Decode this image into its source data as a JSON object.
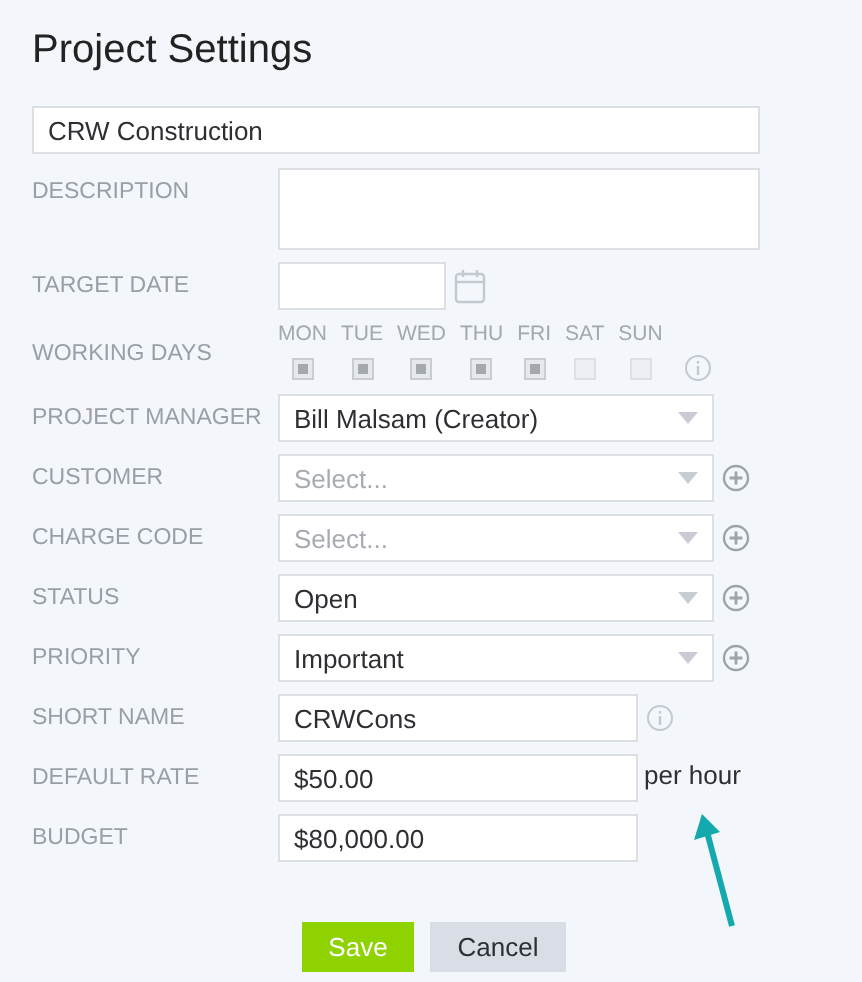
{
  "title": "Project Settings",
  "fields": [
    {
      "kind": "text",
      "value": "CRW Construction"
    },
    {
      "kind": "textarea",
      "label": "DESCRIPTION"
    },
    {
      "kind": "date",
      "label": "TARGET DATE"
    },
    {
      "kind": "days",
      "label": "WORKING DAYS",
      "info": true,
      "days": [
        {
          "label": "MON",
          "checked": true
        },
        {
          "label": "TUE",
          "checked": true
        },
        {
          "label": "WED",
          "checked": true
        },
        {
          "label": "THU",
          "checked": true
        },
        {
          "label": "FRI",
          "checked": true
        },
        {
          "label": "SAT",
          "checked": false
        },
        {
          "label": "SUN",
          "checked": false
        }
      ]
    },
    {
      "kind": "select",
      "label": "PROJECT MANAGER",
      "value": "Bill Malsam (Creator)",
      "addable": false
    },
    {
      "kind": "select",
      "label": "CUSTOMER",
      "placeholder": "Select...",
      "addable": true
    },
    {
      "kind": "select",
      "label": "CHARGE CODE",
      "placeholder": "Select...",
      "addable": true
    },
    {
      "kind": "select",
      "label": "STATUS",
      "value": "Open",
      "addable": true
    },
    {
      "kind": "select",
      "label": "PRIORITY",
      "value": "Important",
      "addable": true
    },
    {
      "kind": "short",
      "label": "SHORT NAME",
      "value": "CRWCons",
      "info": true
    },
    {
      "kind": "short",
      "label": "DEFAULT RATE",
      "value": "$50.00",
      "info": false,
      "suffix": "per hour"
    },
    {
      "kind": "short",
      "label": "BUDGET",
      "value": "$80,000.00",
      "info": false
    }
  ],
  "buttons": [
    {
      "label": "Save",
      "kind": "primary"
    },
    {
      "label": "Cancel",
      "kind": "secondary"
    }
  ]
}
